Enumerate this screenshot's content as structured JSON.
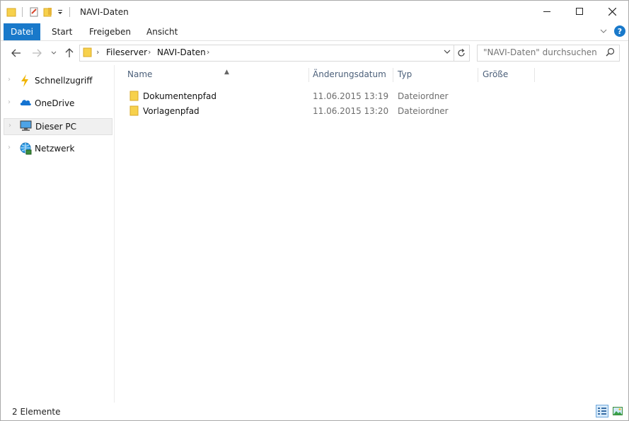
{
  "window": {
    "title": "NAVI-Daten"
  },
  "ribbon": {
    "tabs": [
      {
        "label": "Datei",
        "active": true
      },
      {
        "label": "Start",
        "active": false
      },
      {
        "label": "Freigeben",
        "active": false
      },
      {
        "label": "Ansicht",
        "active": false
      }
    ],
    "help_label": "?"
  },
  "navigation": {
    "breadcrumb": [
      "Fileserver",
      "NAVI-Daten"
    ],
    "search_placeholder": "\"NAVI-Daten\" durchsuchen"
  },
  "sidebar": {
    "items": [
      {
        "label": "Schnellzugriff",
        "icon": "lightning-icon"
      },
      {
        "label": "OneDrive",
        "icon": "cloud-icon"
      },
      {
        "label": "Dieser PC",
        "icon": "computer-icon",
        "selected": true
      },
      {
        "label": "Netzwerk",
        "icon": "network-icon"
      }
    ]
  },
  "list": {
    "columns": [
      "Name",
      "Änderungsdatum",
      "Typ",
      "Größe"
    ],
    "rows": [
      {
        "name": "Dokumentenpfad",
        "date": "11.06.2015 13:19",
        "type": "Dateiordner",
        "size": ""
      },
      {
        "name": "Vorlagenpfad",
        "date": "11.06.2015 13:20",
        "type": "Dateiordner",
        "size": ""
      }
    ]
  },
  "status": {
    "count": "2 Elemente"
  },
  "colors": {
    "accent": "#1979ca",
    "folder": "#f7d14c",
    "header_text": "#4c607a"
  }
}
